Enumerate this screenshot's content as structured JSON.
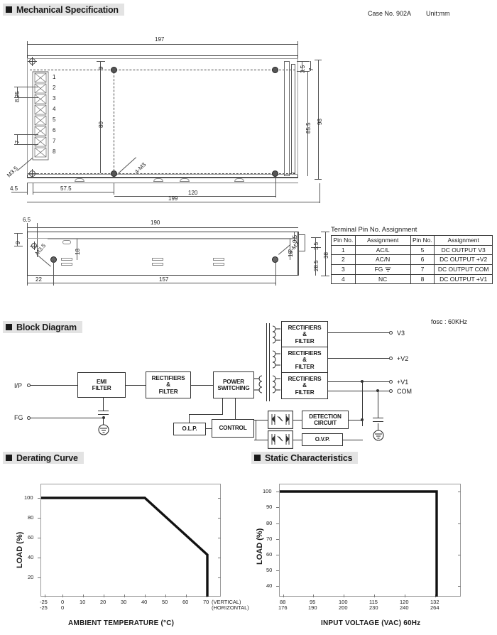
{
  "sections": {
    "mechanical": "Mechanical Specification",
    "block": "Block Diagram",
    "derating": "Derating Curve",
    "static": "Static Characteristics"
  },
  "mechanical": {
    "case_no": "Case No. 902A",
    "unit": "Unit:mm",
    "top_view_dims": {
      "overall_top": "197",
      "hole_offset_top": "9",
      "hole_pitch_vertical": "80",
      "pin_pitch_825": "8.25",
      "pin_pitch_7": "7",
      "screw_note_left": "M3.5",
      "screw_note_center": "4-M3",
      "right_35": "3.5",
      "right_7": "7",
      "right_855": "85.5",
      "right_98": "98",
      "bottom_45": "4.5",
      "bottom_575": "57.5",
      "bottom_120": "120",
      "bottom_199": "199"
    },
    "pin_numbers": [
      "1",
      "2",
      "3",
      "4",
      "5",
      "6",
      "7",
      "8"
    ],
    "side_view_dims": {
      "left_65": "6.5",
      "top_190": "190",
      "left_9": "9",
      "screw_m35": "M3.5",
      "dim_18a": "18",
      "dim_18b": "18",
      "dim_95": "9.5",
      "dim_35": "3.5",
      "dim_285": "28.5",
      "dim_38": "38",
      "screw_3m3": "3-M3",
      "bottom_22": "22",
      "bottom_157": "157"
    },
    "pin_table": {
      "title": "Terminal Pin No. Assignment",
      "headers": [
        "Pin No.",
        "Assignment",
        "Pin No.",
        "Assignment"
      ],
      "rows": [
        [
          "1",
          "AC/L",
          "5",
          "DC OUTPUT V3"
        ],
        [
          "2",
          "AC/N",
          "6",
          "DC OUTPUT +V2"
        ],
        [
          "3",
          "FG",
          "7",
          "DC OUTPUT COM"
        ],
        [
          "4",
          "NC",
          "8",
          "DC OUTPUT +V1"
        ]
      ]
    }
  },
  "block_diagram": {
    "fosc": "fosc : 60KHz",
    "input_label": "I/P",
    "fg_label": "FG",
    "blocks": {
      "emi": "EMI\nFILTER",
      "rect_in": "RECTIFIERS\n&\nFILTER",
      "power_switching": "POWER\nSWITCHING",
      "olp": "O.L.P.",
      "control": "CONTROL",
      "rect_v3": "RECTIFIERS\n&\nFILTER",
      "rect_v2": "RECTIFIERS\n&\nFILTER",
      "rect_v1": "RECTIFIERS\n&\nFILTER",
      "detection": "DETECTION\nCIRCUIT",
      "ovp": "O.V.P."
    },
    "outputs": [
      "V3",
      "+V2",
      "+V1",
      "COM"
    ]
  },
  "chart_data": [
    {
      "type": "line",
      "id": "derating-curve",
      "title": "Derating Curve",
      "xlabel": "AMBIENT TEMPERATURE (°C)",
      "ylabel": "LOAD (%)",
      "xlim": [
        -25,
        75
      ],
      "ylim": [
        0,
        112
      ],
      "grid": false,
      "legend": null,
      "xticks": [
        -25,
        0,
        10,
        20,
        30,
        40,
        50,
        60,
        70
      ],
      "xticklabels_vertical": [
        "-25",
        "0",
        "10",
        "20",
        "30",
        "40",
        "50",
        "60",
        "70"
      ],
      "xticklabels_horizontal": [
        "-25",
        "0",
        "",
        "",
        "",
        "",
        "",
        "",
        ""
      ],
      "x_row_notes": [
        "(VERTICAL)",
        "(HORIZONTAL)"
      ],
      "yticks": [
        20,
        40,
        60,
        80,
        100
      ],
      "yticklabels": [
        "20",
        "40",
        "60",
        "80",
        "100"
      ],
      "series": [
        {
          "name": "Load derating",
          "x": [
            -25,
            40,
            68,
            70
          ],
          "values": [
            100,
            100,
            50,
            0
          ]
        }
      ]
    },
    {
      "type": "line",
      "id": "static-characteristics",
      "title": "Static Characteristics",
      "xlabel": "INPUT VOLTAGE (VAC) 60Hz",
      "ylabel": "LOAD (%)",
      "xlim": [
        85,
        145
      ],
      "ylim": [
        30,
        106
      ],
      "grid": false,
      "legend": null,
      "xticks": [
        88,
        95,
        100,
        115,
        120,
        132
      ],
      "xticklabels_row1": [
        "88",
        "95",
        "100",
        "115",
        "120",
        "132"
      ],
      "xticklabels_row2": [
        "176",
        "190",
        "200",
        "230",
        "240",
        "264"
      ],
      "yticks": [
        40,
        50,
        60,
        70,
        80,
        90,
        100
      ],
      "yticklabels": [
        "40",
        "50",
        "60",
        "70",
        "80",
        "90",
        "100"
      ],
      "series": [
        {
          "name": "Load vs input voltage",
          "x": [
            88,
            132,
            132
          ],
          "values": [
            100,
            100,
            30
          ]
        }
      ]
    }
  ]
}
